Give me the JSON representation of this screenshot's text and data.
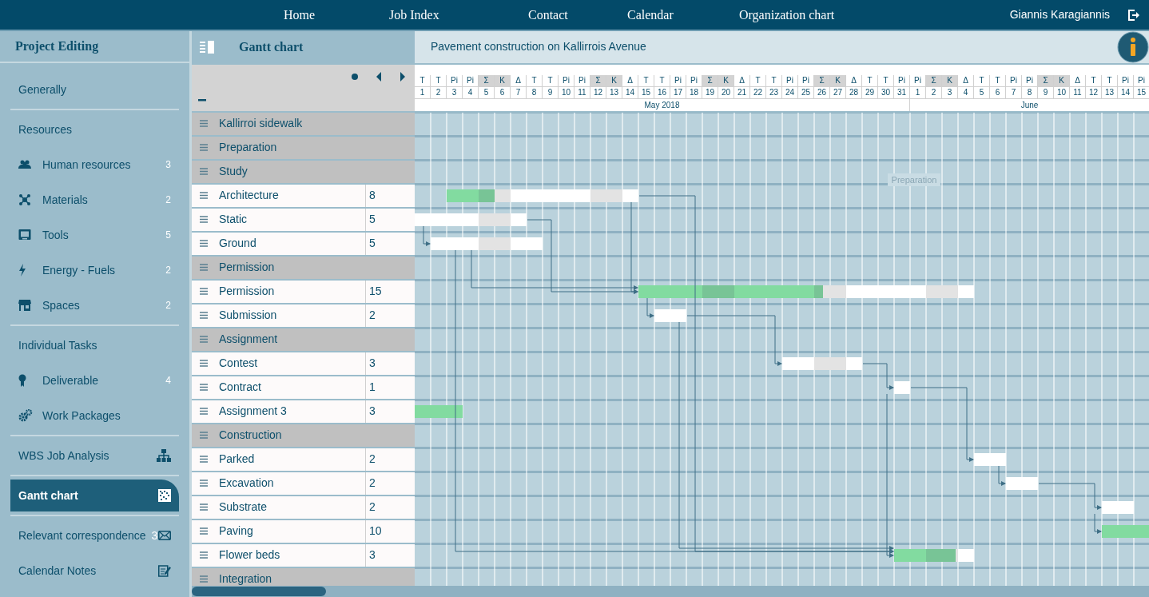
{
  "nav": {
    "items": [
      {
        "label": "Home"
      },
      {
        "label": "Job Index"
      },
      {
        "label": "Contact"
      },
      {
        "label": "Calendar"
      },
      {
        "label": "Organization chart"
      }
    ],
    "user": "Giannis Karagiannis"
  },
  "sidebar": {
    "title": "Project Editing",
    "groups": [
      [
        {
          "label": "Generally",
          "kind": "heading",
          "selected": false
        }
      ],
      [
        {
          "label": "Resources",
          "kind": "heading",
          "selected": false
        },
        {
          "label": "Human resources",
          "kind": "sub",
          "count": "3",
          "selected": false
        },
        {
          "label": "Materials",
          "kind": "sub",
          "count": "2",
          "selected": false
        },
        {
          "label": "Tools",
          "kind": "sub",
          "count": "5",
          "selected": false
        },
        {
          "label": "Energy - Fuels",
          "kind": "sub",
          "count": "2",
          "selected": false
        },
        {
          "label": "Spaces",
          "kind": "sub",
          "count": "2",
          "selected": false
        }
      ],
      [
        {
          "label": "Individual Tasks",
          "kind": "heading",
          "selected": false
        },
        {
          "label": "Deliverable",
          "kind": "sub",
          "count": "4",
          "selected": false
        },
        {
          "label": "Work Packages",
          "kind": "sub",
          "selected": false
        }
      ],
      [
        {
          "label": "WBS Job Analysis",
          "kind": "heading",
          "selected": false
        }
      ],
      [
        {
          "label": "Gantt chart",
          "kind": "heading",
          "selected": true
        }
      ],
      [
        {
          "label": "Relevant correspondence",
          "kind": "heading",
          "count": "3",
          "selected": false
        },
        {
          "label": "Calendar Notes",
          "kind": "heading",
          "selected": false
        }
      ]
    ]
  },
  "gantt": {
    "title": "Gantt chart",
    "project": "Pavement construction on Kallirrois Avenue",
    "drag_label": "Preparation",
    "months": [
      {
        "label": "May 2018",
        "days": [
          {
            "weekday": "T",
            "day": "1",
            "weekend": false
          },
          {
            "weekday": "T",
            "day": "2",
            "weekend": false
          },
          {
            "weekday": "Pi",
            "day": "3",
            "weekend": false
          },
          {
            "weekday": "Pi",
            "day": "4",
            "weekend": false
          },
          {
            "weekday": "Σ",
            "day": "5",
            "weekend": true
          },
          {
            "weekday": "K",
            "day": "6",
            "weekend": true
          },
          {
            "weekday": "Δ",
            "day": "7",
            "weekend": false
          },
          {
            "weekday": "T",
            "day": "8",
            "weekend": false
          },
          {
            "weekday": "T",
            "day": "9",
            "weekend": false
          },
          {
            "weekday": "Pi",
            "day": "10",
            "weekend": false
          },
          {
            "weekday": "Pi",
            "day": "11",
            "weekend": false
          },
          {
            "weekday": "Σ",
            "day": "12",
            "weekend": true
          },
          {
            "weekday": "K",
            "day": "13",
            "weekend": true
          },
          {
            "weekday": "Δ",
            "day": "14",
            "weekend": false
          },
          {
            "weekday": "T",
            "day": "15",
            "weekend": false
          },
          {
            "weekday": "T",
            "day": "16",
            "weekend": false
          },
          {
            "weekday": "Pi",
            "day": "17",
            "weekend": false
          },
          {
            "weekday": "Pi",
            "day": "18",
            "weekend": false
          },
          {
            "weekday": "Σ",
            "day": "19",
            "weekend": true
          },
          {
            "weekday": "K",
            "day": "20",
            "weekend": true
          },
          {
            "weekday": "Δ",
            "day": "21",
            "weekend": false
          },
          {
            "weekday": "T",
            "day": "22",
            "weekend": false
          },
          {
            "weekday": "T",
            "day": "23",
            "weekend": false
          },
          {
            "weekday": "Pi",
            "day": "24",
            "weekend": false
          },
          {
            "weekday": "Pi",
            "day": "25",
            "weekend": false
          },
          {
            "weekday": "Σ",
            "day": "26",
            "weekend": true
          },
          {
            "weekday": "K",
            "day": "27",
            "weekend": true
          },
          {
            "weekday": "Δ",
            "day": "28",
            "weekend": false
          },
          {
            "weekday": "T",
            "day": "29",
            "weekend": false
          },
          {
            "weekday": "T",
            "day": "30",
            "weekend": false
          },
          {
            "weekday": "Pi",
            "day": "31",
            "weekend": false
          }
        ]
      },
      {
        "label": "June",
        "days": [
          {
            "weekday": "Pi",
            "day": "1",
            "weekend": false
          },
          {
            "weekday": "Σ",
            "day": "2",
            "weekend": true
          },
          {
            "weekday": "K",
            "day": "3",
            "weekend": true
          },
          {
            "weekday": "Δ",
            "day": "4",
            "weekend": false
          },
          {
            "weekday": "T",
            "day": "5",
            "weekend": false
          },
          {
            "weekday": "T",
            "day": "6",
            "weekend": false
          },
          {
            "weekday": "Pi",
            "day": "7",
            "weekend": false
          },
          {
            "weekday": "Pi",
            "day": "8",
            "weekend": false
          },
          {
            "weekday": "Σ",
            "day": "9",
            "weekend": true
          },
          {
            "weekday": "K",
            "day": "10",
            "weekend": true
          },
          {
            "weekday": "Δ",
            "day": "11",
            "weekend": false
          },
          {
            "weekday": "T",
            "day": "12",
            "weekend": false
          },
          {
            "weekday": "T",
            "day": "13",
            "weekend": false
          },
          {
            "weekday": "Pi",
            "day": "14",
            "weekend": false
          },
          {
            "weekday": "Pi",
            "day": "15",
            "weekend": false
          }
        ]
      }
    ],
    "rows": [
      {
        "kind": "group",
        "name": "Kallirroi sidewalk"
      },
      {
        "kind": "group",
        "name": "Preparation"
      },
      {
        "kind": "group",
        "name": "Study"
      },
      {
        "kind": "task",
        "name": "Architecture",
        "duration": "8",
        "level": 0.25
      },
      {
        "kind": "task",
        "name": "Static",
        "duration": "5"
      },
      {
        "kind": "task",
        "name": "Ground",
        "duration": "5"
      },
      {
        "kind": "group",
        "name": "Permission"
      },
      {
        "kind": "task",
        "name": "Permission",
        "duration": "15",
        "level": 0.55
      },
      {
        "kind": "task",
        "name": "Submission",
        "duration": "2"
      },
      {
        "kind": "group",
        "name": "Assignment"
      },
      {
        "kind": "task",
        "name": "Contest",
        "duration": "3"
      },
      {
        "kind": "task",
        "name": "Contract",
        "duration": "1"
      },
      {
        "kind": "task",
        "name": "Assignment 3",
        "duration": "3",
        "level": 1
      },
      {
        "kind": "group",
        "name": "Construction"
      },
      {
        "kind": "task",
        "name": "Parked",
        "duration": "2"
      },
      {
        "kind": "task",
        "name": "Excavation",
        "duration": "2"
      },
      {
        "kind": "task",
        "name": "Substrate",
        "duration": "2"
      },
      {
        "kind": "task",
        "name": "Paving",
        "duration": "10",
        "level": 0.3
      },
      {
        "kind": "task",
        "name": "Flower beds",
        "duration": "3",
        "level": 0.77
      },
      {
        "kind": "group",
        "name": "Integration"
      }
    ]
  }
}
